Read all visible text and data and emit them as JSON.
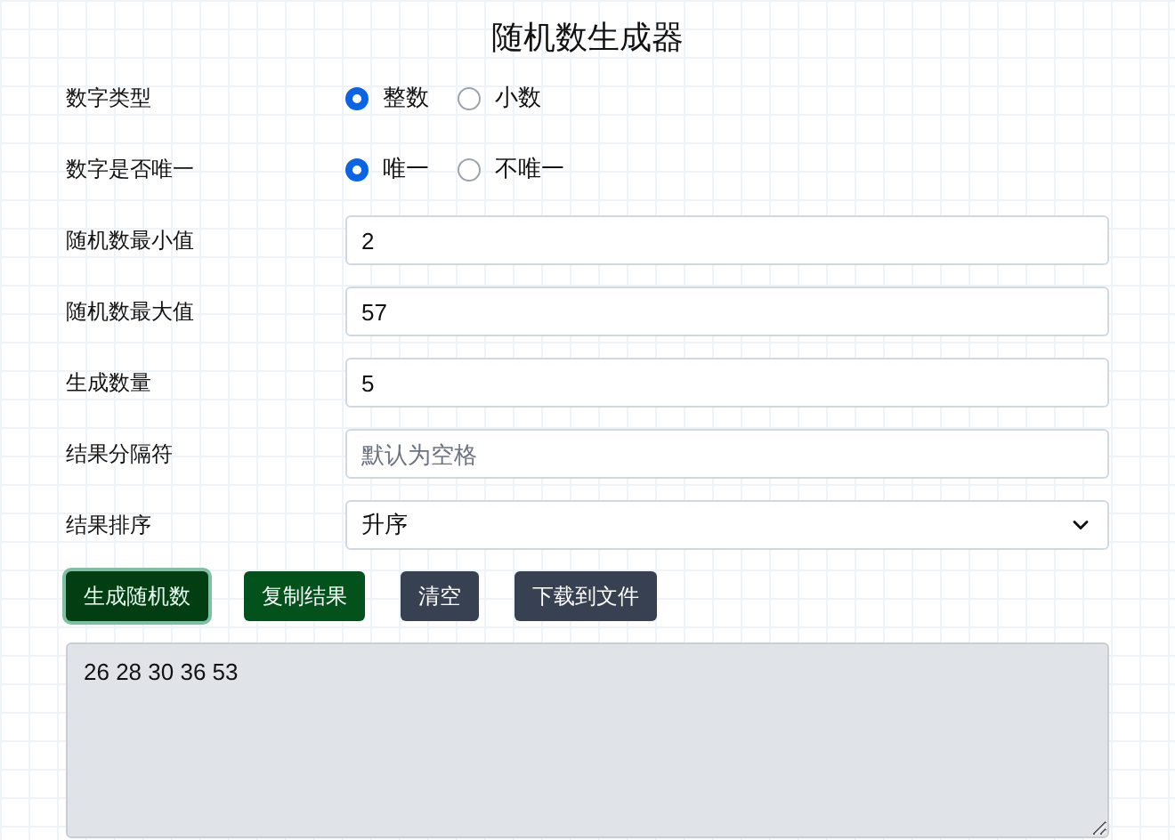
{
  "title": "随机数生成器",
  "fields": [
    {
      "kind": "radio",
      "label": "数字类型",
      "options": [
        {
          "label": "整数",
          "selected": true
        },
        {
          "label": "小数",
          "selected": false
        }
      ]
    },
    {
      "kind": "radio",
      "label": "数字是否唯一",
      "options": [
        {
          "label": "唯一",
          "selected": true
        },
        {
          "label": "不唯一",
          "selected": false
        }
      ]
    },
    {
      "kind": "input",
      "label": "随机数最小值",
      "value": "2"
    },
    {
      "kind": "input",
      "label": "随机数最大值",
      "value": "57"
    },
    {
      "kind": "input",
      "label": "生成数量",
      "value": "5"
    },
    {
      "kind": "input",
      "label": "结果分隔符",
      "placeholder": "默认为空格"
    },
    {
      "kind": "select",
      "label": "结果排序",
      "value": "升序"
    }
  ],
  "buttons": [
    {
      "label": "生成随机数",
      "kind": "dark",
      "focused": true
    },
    {
      "label": "复制结果",
      "kind": "green",
      "focused": false
    },
    {
      "label": "清空",
      "kind": "slate",
      "focused": false
    },
    {
      "label": "下载到文件",
      "kind": "slate",
      "focused": false
    }
  ],
  "result": {
    "value": "26 28 30 36 53"
  }
}
